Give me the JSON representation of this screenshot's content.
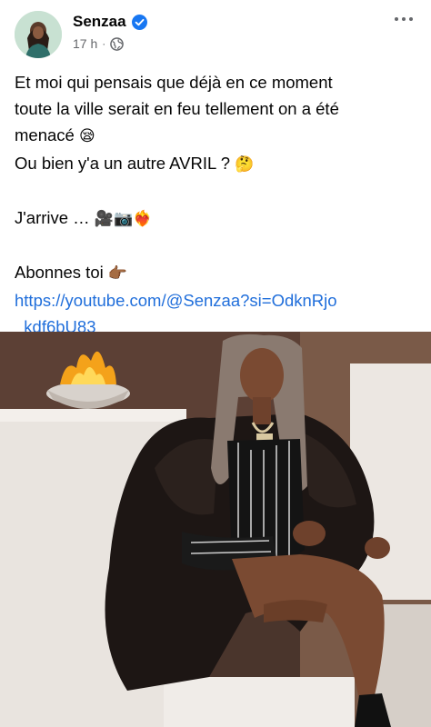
{
  "post": {
    "author": "Senzaa",
    "time": "17 h",
    "separator": "·",
    "lines": [
      "Et moi qui pensais que déjà en ce moment",
      "toute la ville serait en feu tellement on a été",
      "menacé",
      "Ou bien y'a un autre AVRIL ?",
      "J'arrive …",
      "Abonnes toi"
    ],
    "emojis": {
      "sleepy": "😪",
      "thinking": "🤔",
      "camera_video": "🎥📷",
      "heart_fire": "❤️‍🔥",
      "point_right": "👉🏾"
    },
    "link_line1": "https://youtube.com/@Senzaa?si=OdknRjo",
    "link_line2": "_kdf6bU83"
  },
  "icons": {
    "verified": "verified-badge-icon",
    "globe": "globe-icon",
    "more": "more-options-icon"
  },
  "colors": {
    "text": "#050505",
    "meta": "#65676b",
    "link": "#216fdb",
    "verified": "#1877f2"
  }
}
